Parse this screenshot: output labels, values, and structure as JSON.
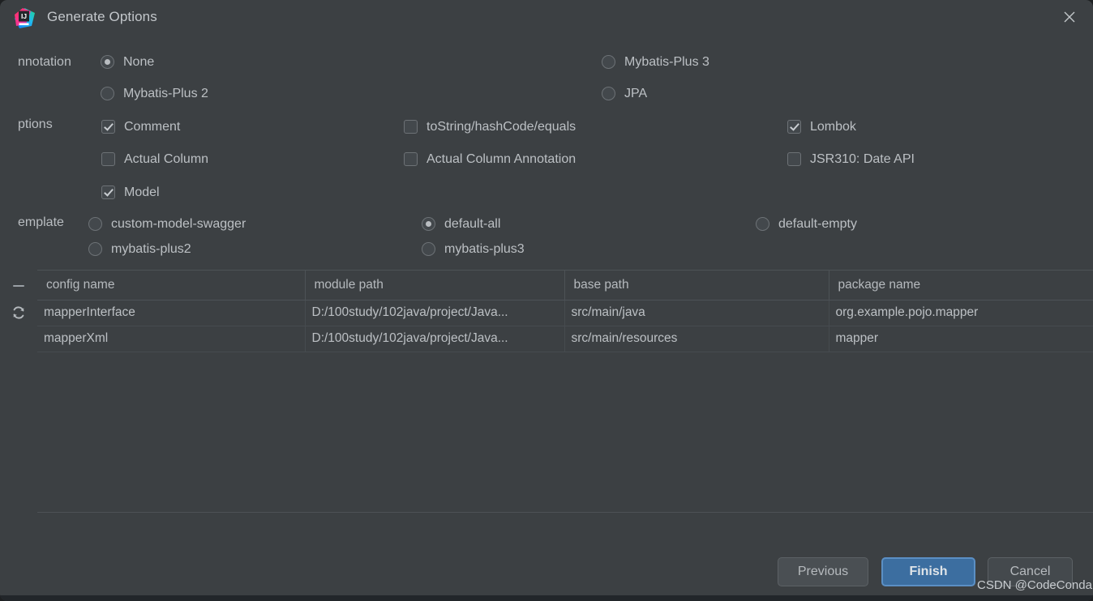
{
  "window": {
    "title": "Generate Options",
    "app_icon": "intellij-idea-icon",
    "close_icon": "close-icon"
  },
  "sections": {
    "annotation": {
      "label": "nnotation",
      "options": [
        {
          "label": "None",
          "selected": true
        },
        {
          "label": "Mybatis-Plus 3",
          "selected": false
        },
        {
          "label": "Mybatis-Plus 2",
          "selected": false
        },
        {
          "label": "JPA",
          "selected": false
        }
      ]
    },
    "options": {
      "label": "ptions",
      "items": [
        {
          "label": "Comment",
          "checked": true
        },
        {
          "label": "toString/hashCode/equals",
          "checked": false
        },
        {
          "label": "Lombok",
          "checked": true
        },
        {
          "label": "Actual Column",
          "checked": false
        },
        {
          "label": "Actual Column Annotation",
          "checked": false
        },
        {
          "label": "JSR310: Date API",
          "checked": false
        },
        {
          "label": "Model",
          "checked": true
        }
      ]
    },
    "template": {
      "label": "emplate",
      "options": [
        {
          "label": "custom-model-swagger",
          "selected": false
        },
        {
          "label": "default-all",
          "selected": true
        },
        {
          "label": "default-empty",
          "selected": false
        },
        {
          "label": "mybatis-plus2",
          "selected": false
        },
        {
          "label": "mybatis-plus3",
          "selected": false
        }
      ]
    }
  },
  "table": {
    "toolbar": [
      {
        "icon": "minus-icon"
      },
      {
        "icon": "refresh-icon"
      }
    ],
    "columns": [
      "config name",
      "module path",
      "base path",
      "package name"
    ],
    "rows": [
      {
        "config_name": "mapperInterface",
        "module_path": "D:/100study/102java/project/Java...",
        "base_path": "src/main/java",
        "package_name": "org.example.pojo.mapper"
      },
      {
        "config_name": "mapperXml",
        "module_path": "D:/100study/102java/project/Java...",
        "base_path": "src/main/resources",
        "package_name": "mapper"
      }
    ]
  },
  "footer": {
    "previous_label": "Previous",
    "finish_label": "Finish",
    "cancel_label": "Cancel",
    "watermark": "CSDN @CodeConda"
  },
  "colors": {
    "dialog_bg": "#3c4043",
    "text": "#bcc0c4",
    "accent_button": "#3c6ea0",
    "accent_border": "#5b8fc4",
    "divider": "#4d5256"
  }
}
